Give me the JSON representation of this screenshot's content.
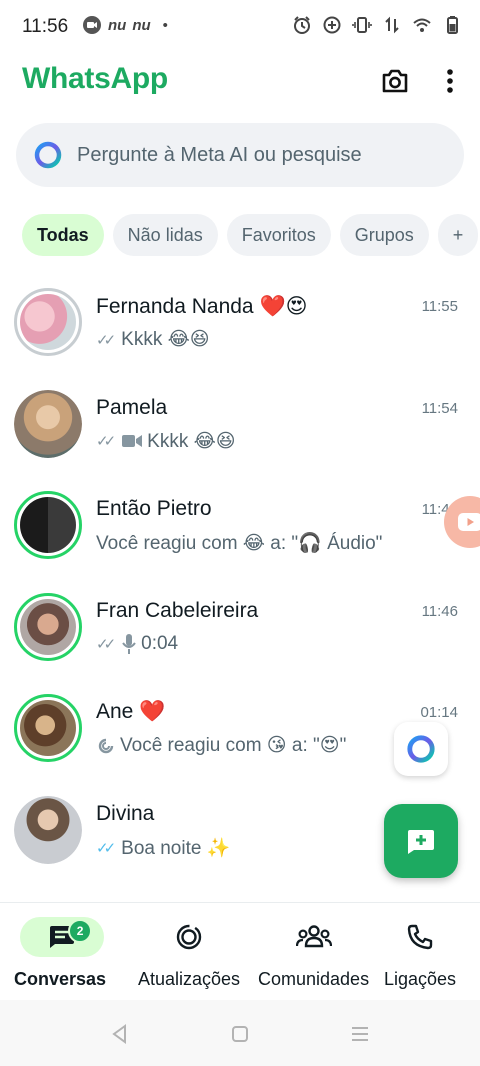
{
  "status_bar": {
    "time": "11:56",
    "notif_text_1": "nu",
    "notif_text_2": "nu",
    "dot": "•"
  },
  "header": {
    "title": "WhatsApp",
    "brand_color": "#1daa61"
  },
  "search": {
    "placeholder": "Pergunte à Meta AI ou pesquise"
  },
  "filters": [
    {
      "label": "Todas",
      "active": true
    },
    {
      "label": "Não lidas"
    },
    {
      "label": "Favoritos"
    },
    {
      "label": "Grupos"
    },
    {
      "label": "+"
    }
  ],
  "chats": [
    {
      "name": "Fernanda Nanda ❤️😍",
      "time": "11:55",
      "ticks": "✓✓",
      "preview": "Kkkk 😂😆"
    },
    {
      "name": "Pamela",
      "time": "11:54",
      "ticks": "✓✓",
      "preview": "Kkkk 😂😆"
    },
    {
      "name": "Então Pietro",
      "time": "11:48",
      "preview": "Você reagiu com 😂 a: \"🎧 Áudio\""
    },
    {
      "name": "Fran Cabeleireira",
      "time": "11:46",
      "ticks": "✓✓",
      "preview": "0:04"
    },
    {
      "name": "Ane ❤️",
      "time": "01:14",
      "preview": "Você reagiu com 😘 a: \"😍\""
    },
    {
      "name": "Divina",
      "time": "",
      "ticks": "✓✓",
      "preview": "Boa noite ✨"
    }
  ],
  "bottom_nav": {
    "chats_label": "Conversas",
    "chats_badge": "2",
    "updates_label": "Atualizações",
    "communities_label": "Comunidades",
    "calls_label": "Ligações"
  }
}
